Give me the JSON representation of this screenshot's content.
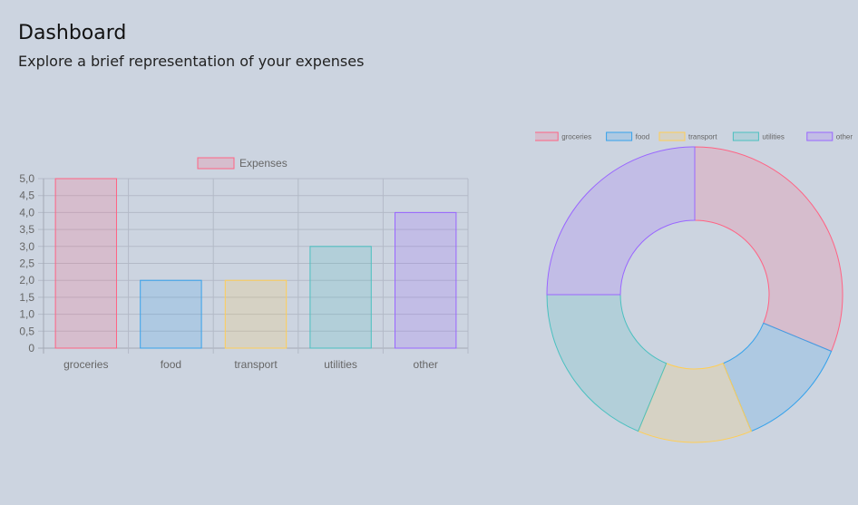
{
  "page": {
    "title": "Dashboard",
    "subtitle": "Explore a brief representation of your expenses"
  },
  "colors": {
    "groceries": {
      "fill": "rgba(255,99,132,0.2)",
      "stroke": "#ff6384"
    },
    "food": {
      "fill": "rgba(54,162,235,0.2)",
      "stroke": "#36a2eb"
    },
    "transport": {
      "fill": "rgba(255,206,86,0.2)",
      "stroke": "#ffce56"
    },
    "utilities": {
      "fill": "rgba(75,192,192,0.2)",
      "stroke": "#4bc0c0"
    },
    "other": {
      "fill": "rgba(153,102,255,0.2)",
      "stroke": "#9966ff"
    }
  },
  "chart_data": [
    {
      "type": "bar",
      "categories": [
        "groceries",
        "food",
        "transport",
        "utilities",
        "other"
      ],
      "series": [
        {
          "name": "Expenses",
          "values": [
            5,
            2,
            2,
            3,
            4
          ]
        }
      ],
      "ylim": [
        0,
        5
      ],
      "yticks": [
        "0",
        "0,5",
        "1,0",
        "1,5",
        "2,0",
        "2,5",
        "3,0",
        "3,5",
        "4,0",
        "4,5",
        "5,0"
      ],
      "grid": true,
      "legend": "top"
    },
    {
      "type": "pie",
      "variant": "doughnut",
      "labels": [
        "groceries",
        "food",
        "transport",
        "utilities",
        "other"
      ],
      "values": [
        5,
        2,
        2,
        3,
        4
      ],
      "legend": "top"
    }
  ]
}
